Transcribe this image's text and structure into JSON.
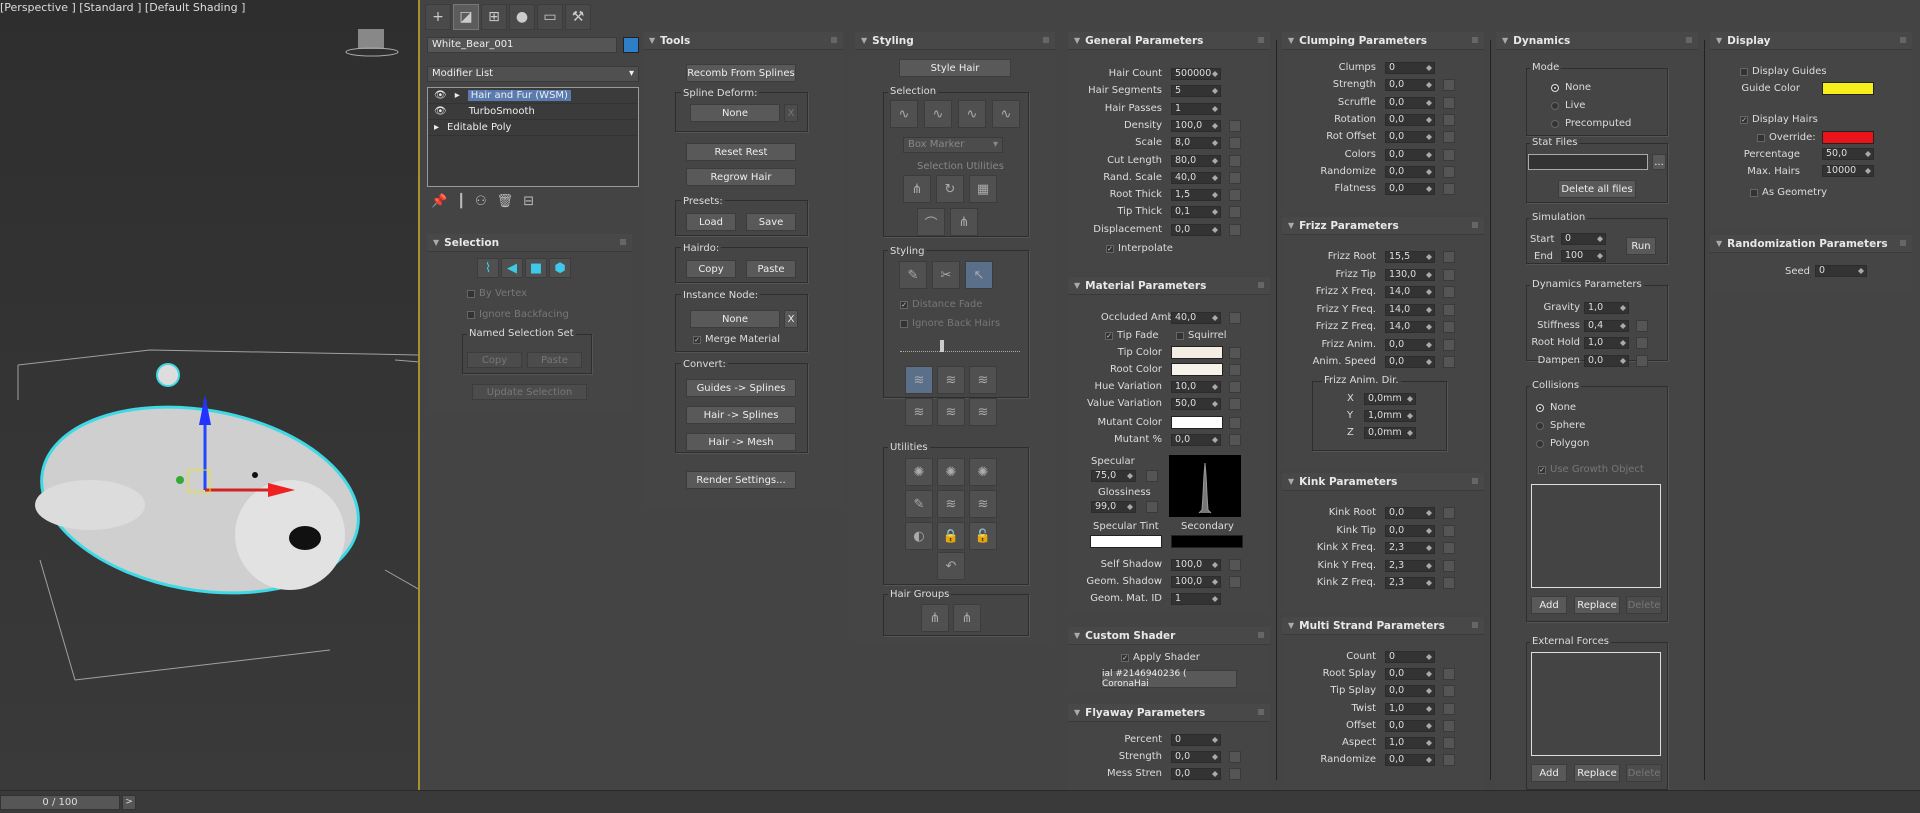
{
  "viewport": {
    "label": "[Perspective ] [Standard ] [Default Shading ]"
  },
  "timeline": {
    "frame": "0 / 100",
    "next": ">"
  },
  "toolbar": {
    "tabs": [
      "create-icon",
      "modify-icon",
      "hierarchy-icon",
      "motion-icon",
      "display-icon",
      "utilities-icon"
    ]
  },
  "modifier": {
    "object_name": "White_Bear_001",
    "object_color": "#2f7fc8",
    "list_label": "Modifier List",
    "stack": [
      {
        "label": "Hair and Fur (WSM)",
        "selected": true
      },
      {
        "label": "TurboSmooth",
        "selected": false
      },
      {
        "label": "Editable Poly",
        "selected": false
      }
    ]
  },
  "selection": {
    "title": "Selection",
    "by_vertex": "By Vertex",
    "ignore_backfacing": "Ignore Backfacing",
    "named_set": "Named Selection Set",
    "copy": "Copy",
    "paste": "Paste",
    "update": "Update Selection"
  },
  "tools": {
    "title": "Tools",
    "recomb": "Recomb From Splines",
    "spline_deform": "Spline Deform:",
    "none": "None",
    "x": "X",
    "reset_rest": "Reset Rest",
    "regrow": "Regrow Hair",
    "presets": "Presets:",
    "load": "Load",
    "save": "Save",
    "hairdo": "Hairdo:",
    "copy": "Copy",
    "paste": "Paste",
    "instance_node": "Instance Node:",
    "none2": "None",
    "merge": "Merge Material",
    "convert": "Convert:",
    "guides_splines": "Guides -> Splines",
    "hair_splines": "Hair -> Splines",
    "hair_mesh": "Hair -> Mesh",
    "render_settings": "Render Settings..."
  },
  "styling": {
    "title": "Styling",
    "style_hair": "Style Hair",
    "selection": "Selection",
    "box_marker": "Box Marker",
    "selection_utilities": "Selection Utilities",
    "styling": "Styling",
    "distance_fade": "Distance Fade",
    "ignore_back": "Ignore Back Hairs",
    "utilities": "Utilities",
    "hair_groups": "Hair Groups"
  },
  "general": {
    "title": "General Parameters",
    "params": [
      [
        "Hair Count",
        "500000"
      ],
      [
        "Hair Segments",
        "5"
      ],
      [
        "Hair Passes",
        "1"
      ],
      [
        "Density",
        "100,0"
      ],
      [
        "Scale",
        "8,0"
      ],
      [
        "Cut Length",
        "80,0"
      ],
      [
        "Rand. Scale",
        "40,0"
      ],
      [
        "Root Thick",
        "1,5"
      ],
      [
        "Tip Thick",
        "0,1"
      ],
      [
        "Displacement",
        "0,0"
      ]
    ],
    "interpolate": "Interpolate"
  },
  "material": {
    "title": "Material Parameters",
    "occluded": [
      "Occluded Amb.",
      "40,0"
    ],
    "tip_fade": "Tip Fade",
    "squirrel": "Squirrel",
    "tip_color": "Tip Color",
    "tip_color_val": "#f3ede4",
    "root_color": "Root Color",
    "root_color_val": "#f7f2ea",
    "hue": [
      "Hue Variation",
      "10,0"
    ],
    "value": [
      "Value Variation",
      "50,0"
    ],
    "mutant_color": "Mutant Color",
    "mutant_color_val": "#ffffff",
    "mutant_pct": [
      "Mutant %",
      "0,0"
    ],
    "specular": "Specular",
    "specular_val": "75,0",
    "glossiness": "Glossiness",
    "gloss_val": "99,0",
    "spec_tint": "Specular Tint",
    "secondary": "Secondary",
    "self_shadow": [
      "Self Shadow",
      "100,0"
    ],
    "geom_shadow": [
      "Geom. Shadow",
      "100,0"
    ],
    "geom_mat": [
      "Geom. Mat. ID",
      "1"
    ]
  },
  "custom_shader": {
    "title": "Custom Shader",
    "apply": "Apply Shader",
    "shader": "ial #2146940236  ( CoronaHai"
  },
  "flyaway": {
    "title": "Flyaway Parameters",
    "params": [
      [
        "Percent",
        "0"
      ],
      [
        "Strength",
        "0,0"
      ],
      [
        "Mess Stren",
        "0,0"
      ]
    ]
  },
  "clumping": {
    "title": "Clumping Parameters",
    "params": [
      [
        "Clumps",
        "0"
      ],
      [
        "Strength",
        "0,0"
      ],
      [
        "Scruffle",
        "0,0"
      ],
      [
        "Rotation",
        "0,0"
      ],
      [
        "Rot Offset",
        "0,0"
      ],
      [
        "Colors",
        "0,0"
      ],
      [
        "Randomize",
        "0,0"
      ],
      [
        "Flatness",
        "0,0"
      ]
    ]
  },
  "frizz": {
    "title": "Frizz Parameters",
    "params": [
      [
        "Frizz Root",
        "15,5"
      ],
      [
        "Frizz Tip",
        "130,0"
      ],
      [
        "Frizz X Freq.",
        "14,0"
      ],
      [
        "Frizz Y Freq.",
        "14,0"
      ],
      [
        "Frizz Z Freq.",
        "14,0"
      ],
      [
        "Frizz Anim.",
        "0,0"
      ],
      [
        "Anim. Speed",
        "0,0"
      ]
    ],
    "dir": "Frizz Anim. Dir.",
    "xyz": [
      [
        "X",
        "0,0mm"
      ],
      [
        "Y",
        "1,0mm"
      ],
      [
        "Z",
        "0,0mm"
      ]
    ]
  },
  "kink": {
    "title": "Kink Parameters",
    "params": [
      [
        "Kink Root",
        "0,0"
      ],
      [
        "Kink Tip",
        "0,0"
      ],
      [
        "Kink X Freq.",
        "2,3"
      ],
      [
        "Kink Y Freq.",
        "2,3"
      ],
      [
        "Kink Z Freq.",
        "2,3"
      ]
    ]
  },
  "multistrand": {
    "title": "Multi Strand Parameters",
    "params": [
      [
        "Count",
        "0"
      ],
      [
        "Root Splay",
        "0,0"
      ],
      [
        "Tip Splay",
        "0,0"
      ],
      [
        "Twist",
        "1,0"
      ],
      [
        "Offset",
        "0,0"
      ],
      [
        "Aspect",
        "1,0"
      ],
      [
        "Randomize",
        "0,0"
      ]
    ]
  },
  "dynamics": {
    "title": "Dynamics",
    "mode": "Mode",
    "none": "None",
    "live": "Live",
    "precomputed": "Precomputed",
    "stat_files": "Stat Files",
    "browse": "...",
    "delete_all": "Delete all files",
    "simulation": "Simulation",
    "start": "Start",
    "start_val": "0",
    "end": "End",
    "end_val": "100",
    "run": "Run",
    "dyn_params": "Dynamics Parameters",
    "params": [
      [
        "Gravity",
        "1,0"
      ],
      [
        "Stiffness",
        "0,4"
      ],
      [
        "Root Hold",
        "1,0"
      ],
      [
        "Dampen",
        "0,0"
      ]
    ],
    "collisions": "Collisions",
    "sphere": "Sphere",
    "polygon": "Polygon",
    "use_growth": "Use Growth Object",
    "add": "Add",
    "replace": "Replace",
    "delete": "Delete",
    "external_forces": "External Forces"
  },
  "display": {
    "title": "Display",
    "display_guides": "Display Guides",
    "guide_color": "Guide Color",
    "guide_color_val": "#f6ee1a",
    "display_hairs": "Display Hairs",
    "override": "Override:",
    "override_color": "#e8141a",
    "percentage": "Percentage",
    "percentage_val": "50,0",
    "max_hairs": "Max. Hairs",
    "max_hairs_val": "10000",
    "as_geometry": "As Geometry"
  },
  "randomization": {
    "title": "Randomization Parameters",
    "seed": "Seed",
    "seed_val": "0"
  }
}
